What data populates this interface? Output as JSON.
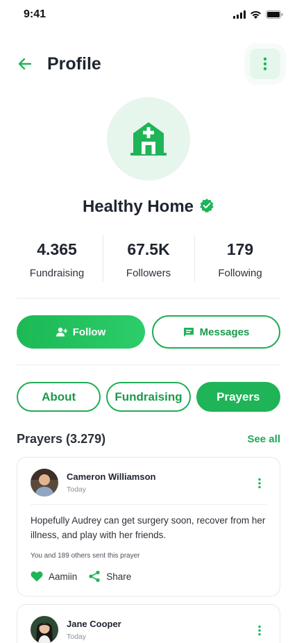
{
  "status_bar": {
    "time": "9:41"
  },
  "header": {
    "title": "Profile"
  },
  "profile": {
    "name": "Healthy Home",
    "verified": true
  },
  "stats": [
    {
      "value": "4.365",
      "label": "Fundraising"
    },
    {
      "value": "67.5K",
      "label": "Followers"
    },
    {
      "value": "179",
      "label": "Following"
    }
  ],
  "actions": {
    "follow_label": "Follow",
    "messages_label": "Messages"
  },
  "tabs": [
    {
      "label": "About",
      "active": false
    },
    {
      "label": "Fundraising",
      "active": false
    },
    {
      "label": "Prayers",
      "active": true
    }
  ],
  "prayers": {
    "title": "Prayers (3.279)",
    "see_all": "See all",
    "items": [
      {
        "name": "Cameron Williamson",
        "time": "Today",
        "text": "Hopefully Audrey can get surgery soon, recover from her illness, and play with her friends.",
        "sent": "You and 189 others sent this prayer",
        "like_label": "Aamiin",
        "share_label": "Share"
      },
      {
        "name": "Jane Cooper",
        "time": "Today"
      }
    ]
  },
  "colors": {
    "accent": "#1eb457",
    "accent_light": "#e6f6ec",
    "text": "#1f2430"
  }
}
